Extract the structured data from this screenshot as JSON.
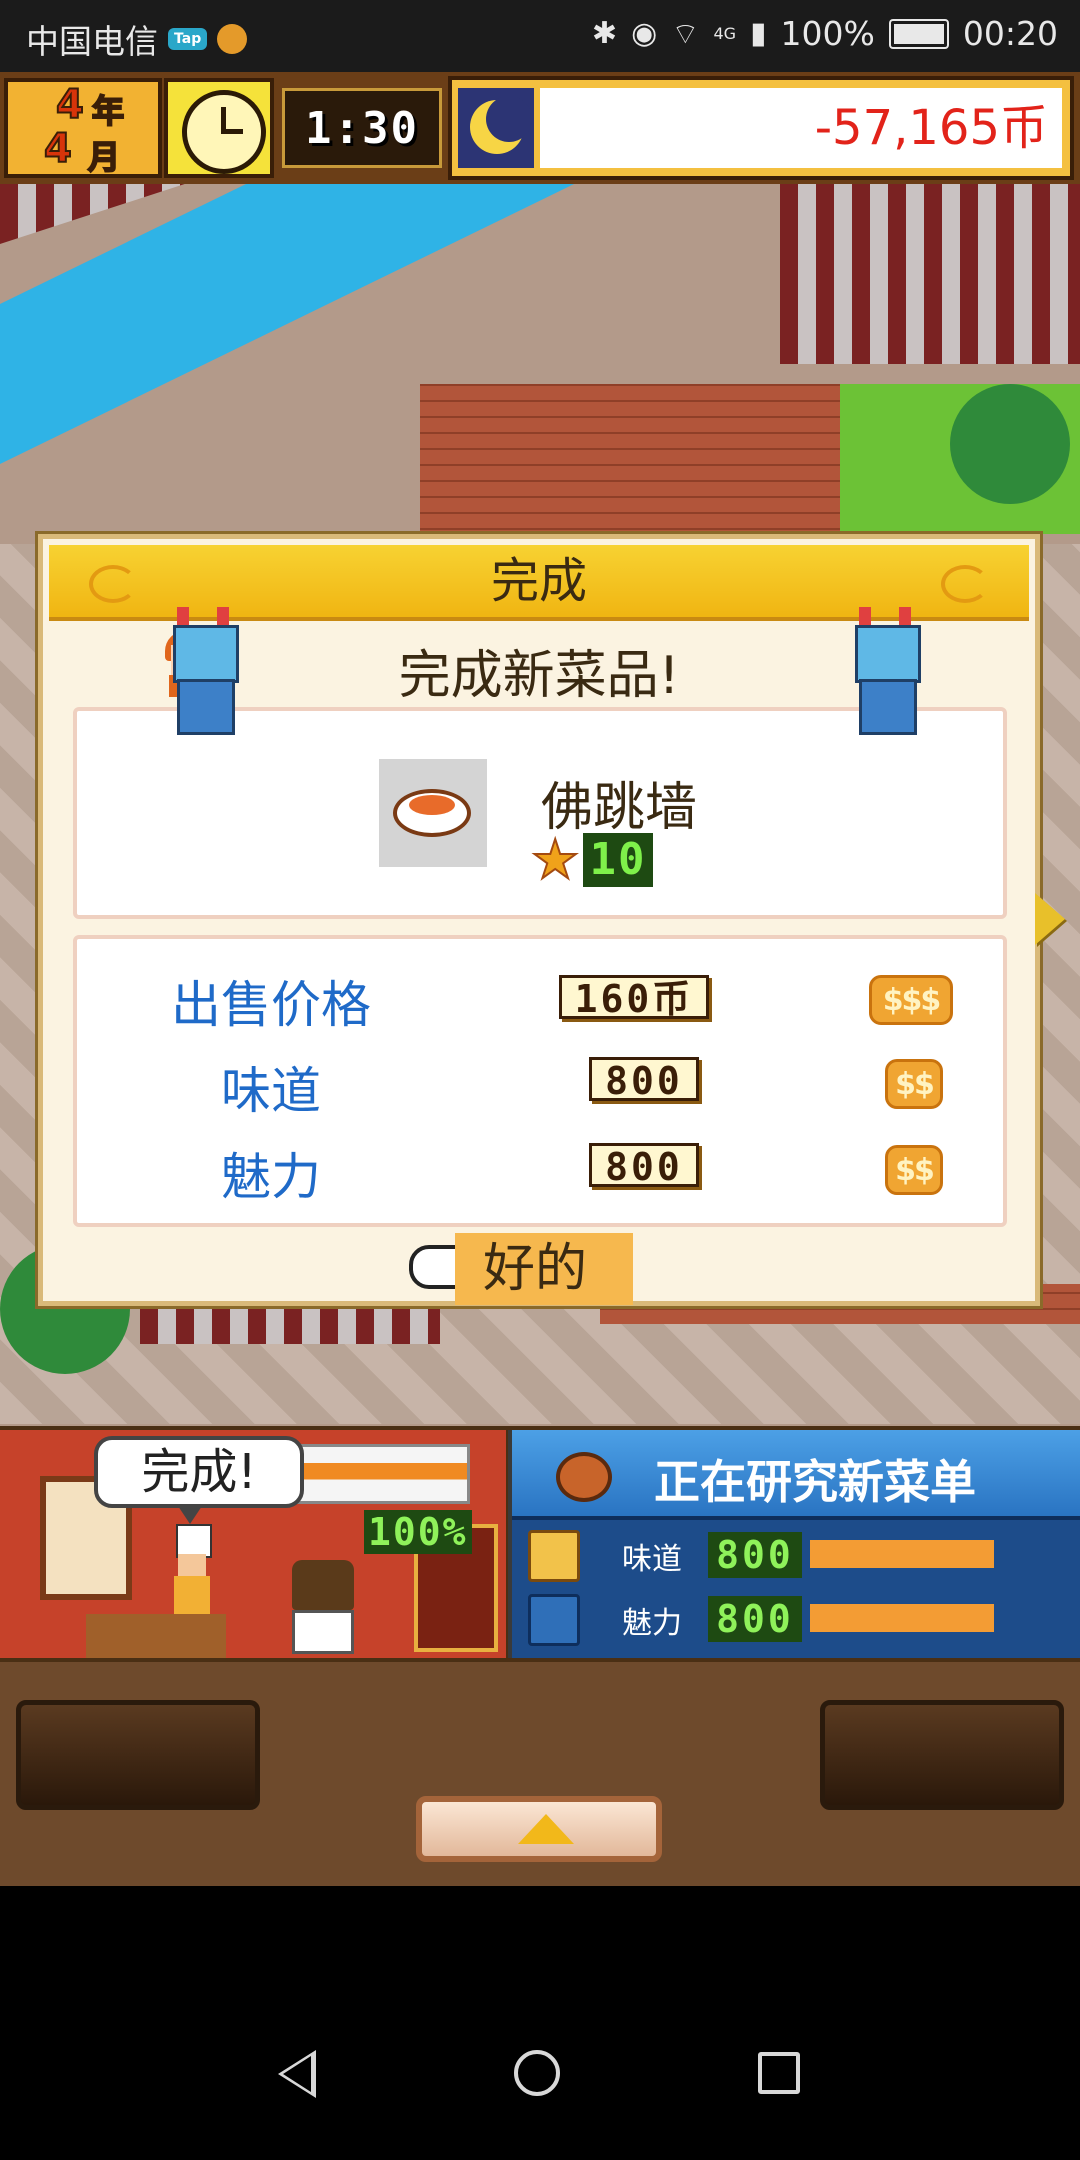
{
  "status_bar": {
    "carrier": "中国电信",
    "tap_badge": "Tap",
    "network": "4G",
    "battery": "100%",
    "time": "00:20"
  },
  "hud": {
    "year_num": "4",
    "year_unit": "年",
    "month_num": "4",
    "month_unit": "月",
    "game_time": "1:30",
    "money": "-57,165币"
  },
  "dialog": {
    "title": "完成",
    "subtitle": "完成新菜品!",
    "dish_name": "佛跳墙",
    "dish_level": "10",
    "stats": [
      {
        "label": "出售价格",
        "value": "160币",
        "coins": "$$$"
      },
      {
        "label": "味道",
        "value": "800",
        "coins": "$$"
      },
      {
        "label": "魅力",
        "value": "800",
        "coins": "$$"
      }
    ],
    "ok_label": "好的"
  },
  "research": {
    "bubble": "完成!",
    "progress": "100%",
    "title": "正在研究新菜单",
    "rows": [
      {
        "label": "味道",
        "value": "800"
      },
      {
        "label": "魅力",
        "value": "800"
      }
    ]
  },
  "colors": {
    "accent_gold": "#f0b512",
    "money_red": "#e2231a",
    "stat_blue": "#1f6ac8",
    "panel_blue": "#1d4c8a"
  }
}
